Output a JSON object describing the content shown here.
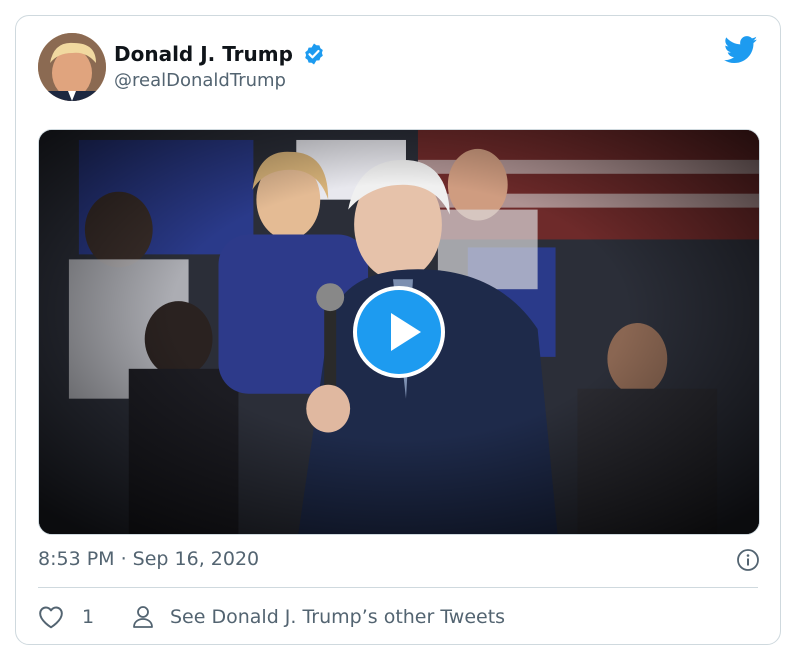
{
  "tweet": {
    "author_name": "Donald J. Trump",
    "handle": "@realDonaldTrump",
    "timestamp": "8:53 PM · Sep 16, 2020",
    "like_count": "1",
    "other_tweets_label": "See Donald J. Trump’s other Tweets"
  },
  "icons": {
    "avatar": "avatar-photo",
    "verified": "verified-badge-icon",
    "brand": "twitter-bird-icon",
    "play": "play-icon",
    "info": "info-icon",
    "like": "heart-icon",
    "profile": "person-icon"
  },
  "colors": {
    "accent": "#1d9bf0",
    "text_primary": "#0f1419",
    "text_secondary": "#536471",
    "border": "#cfd9de"
  }
}
